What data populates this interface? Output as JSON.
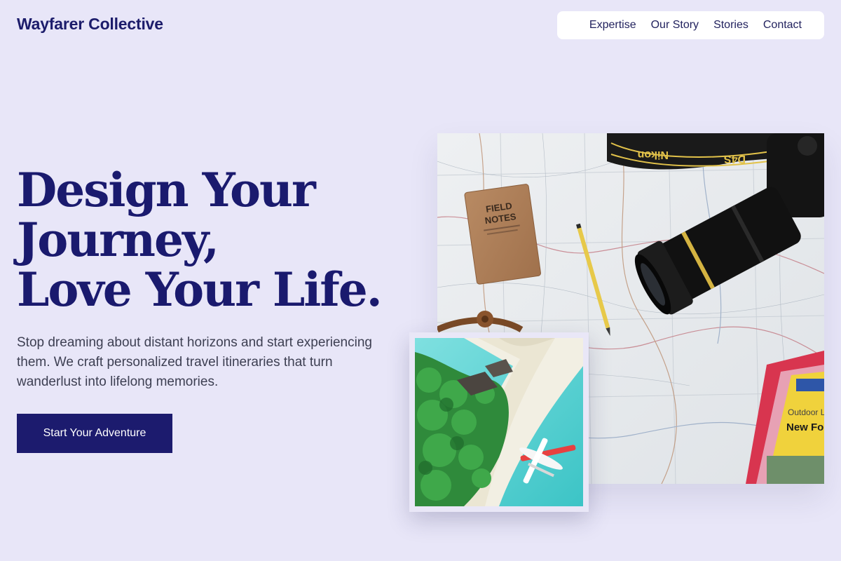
{
  "brand": {
    "name": "Wayfarer Collective"
  },
  "nav": {
    "items": [
      {
        "label": "Expertise"
      },
      {
        "label": "Our Story"
      },
      {
        "label": "Stories"
      },
      {
        "label": "Contact"
      }
    ]
  },
  "hero": {
    "headline_lines": [
      "Design Your",
      "Journey,",
      "Love Your Life."
    ],
    "subtext": "Stop dreaming about distant horizons and start experiencing them. We craft personalized travel itineraries that turn wanderlust into lifelong memories.",
    "cta_label": "Start Your Adventure"
  },
  "images": {
    "main": {
      "subject": "map-camera-flatlay",
      "notebook_text": [
        "FIELD",
        "NOTES"
      ],
      "strap_text": "Nikon",
      "strap_text_2": "D4S",
      "guide_text": [
        "New Fo",
        "Outdoor L"
      ]
    },
    "inset": {
      "subject": "tropical-island-seaplane"
    }
  },
  "colors": {
    "background": "#e8e6f8",
    "brand_navy": "#1a1a6e",
    "nav_bg": "#ffffff",
    "body_text": "#3d3f52"
  }
}
